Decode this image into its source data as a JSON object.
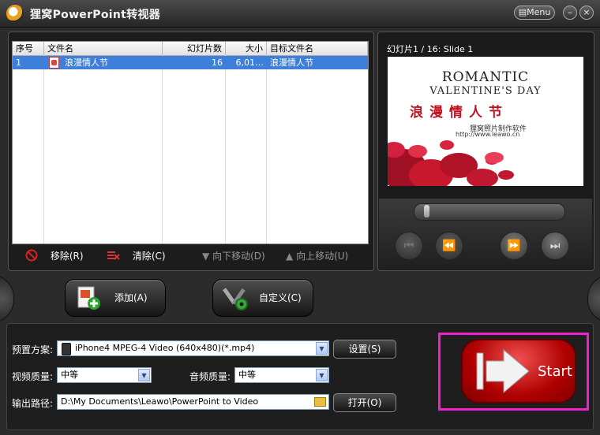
{
  "window": {
    "title": "狸窝PowerPoint转视器",
    "menu_label": "Menu",
    "minimize_symbol": "–",
    "close_symbol": "×"
  },
  "file_table": {
    "headers": [
      "序号",
      "文件名",
      "幻灯片数",
      "大小",
      "目标文件名"
    ],
    "rows": [
      {
        "index": "1",
        "file_name": "浪漫情人节",
        "slides": "16",
        "size": "6,01…",
        "target_name": "浪漫情人节"
      }
    ]
  },
  "list_toolbar": {
    "remove_label": "移除(R)",
    "clear_label": "清除(C)",
    "move_down_label": "向下移动(D)",
    "move_up_label": "向上移动(U)"
  },
  "preview": {
    "slide_label": "幻灯片1 / 16: Slide 1",
    "slide_title_line1": "ROMANTIC",
    "slide_title_line2": "VALENTINE'S DAY",
    "slide_cn_title": "浪漫情人节",
    "slide_sub1": "狸窝照片制作软件",
    "slide_sub2": "http://www.leawo.cn",
    "progress": 0
  },
  "actions": {
    "add_label": "添加(A)",
    "customize_label": "自定义(C)"
  },
  "settings": {
    "preset_label": "预置方案:",
    "preset_value": "iPhone4 MPEG-4 Video (640x480)(*.mp4)",
    "settings_button": "设置(S)",
    "video_quality_label": "视频质量:",
    "video_quality_value": "中等",
    "audio_quality_label": "音频质量:",
    "audio_quality_value": "中等",
    "output_path_label": "输出路径:",
    "output_path_value": "D:\\My Documents\\Leawo\\PowerPoint to Video",
    "open_button": "打开(O)"
  },
  "start": {
    "label": "Start"
  },
  "colors": {
    "selection": "#3d7fd9",
    "start_red": "#c00000",
    "highlight_frame": "#ee22cc"
  },
  "icons": [
    "app-logo-icon",
    "remove-icon",
    "clear-icon",
    "move-down-icon",
    "move-up-icon",
    "add-file-icon",
    "customize-tools-icon",
    "prev-track-icon",
    "rewind-icon",
    "fast-forward-icon",
    "next-track-icon",
    "folder-icon",
    "start-arrow-icon"
  ]
}
